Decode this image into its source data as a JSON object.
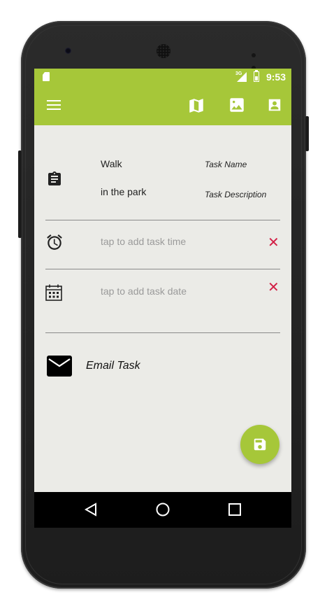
{
  "statusbar": {
    "network": "3G",
    "time": "9:53"
  },
  "toolbar": {
    "menu_icon": "menu-icon",
    "actions": [
      "map-icon",
      "image-icon",
      "contact-icon"
    ]
  },
  "task": {
    "name_value": "Walk",
    "name_label": "Task Name",
    "description_value": "in the park",
    "description_label": "Task Description",
    "time_placeholder": "tap to add task time",
    "date_placeholder": "tap to add task date",
    "clear_symbol": "✕",
    "email_label": "Email Task"
  },
  "fab": {
    "icon": "save-icon"
  },
  "navbar": {
    "buttons": [
      "back-icon",
      "home-icon",
      "recents-icon"
    ]
  },
  "colors": {
    "accent": "#a6c739",
    "background": "#ebebe7",
    "clear": "#d21f45"
  }
}
